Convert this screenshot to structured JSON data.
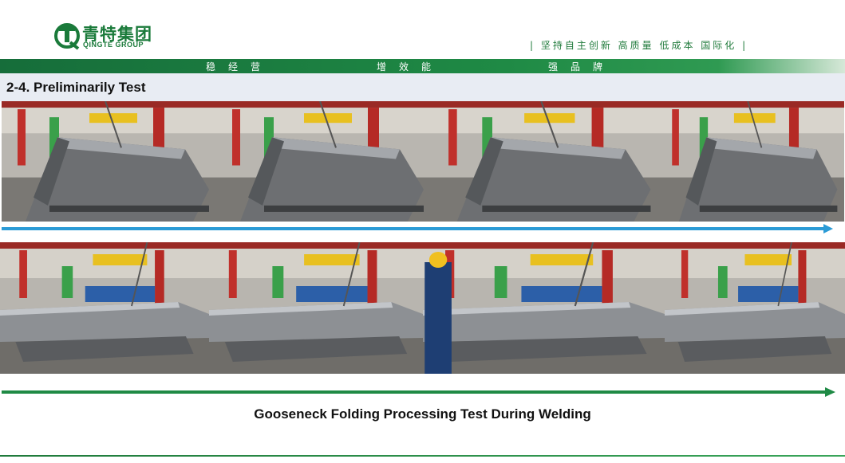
{
  "header": {
    "logo_cn": "青特集团",
    "logo_en": "QINGTE GROUP",
    "slogan": "| 坚持自主创新 高质量 低成本 国际化 |",
    "bar_words": [
      "稳经营",
      "增效能",
      "强品牌"
    ]
  },
  "section_title": "2-4. Preliminarily Test",
  "caption": "Gooseneck Folding Processing Test  During Welding",
  "colors": {
    "brand_green": "#1f7a3b",
    "arrow_blue": "#2b9bd6",
    "arrow_green": "#1f8a45"
  },
  "photos": {
    "top_row": [
      "factory-photo",
      "factory-photo",
      "factory-photo",
      "factory-photo"
    ],
    "bottom_row": [
      "factory-photo",
      "factory-photo",
      "factory-photo",
      "factory-photo"
    ]
  }
}
